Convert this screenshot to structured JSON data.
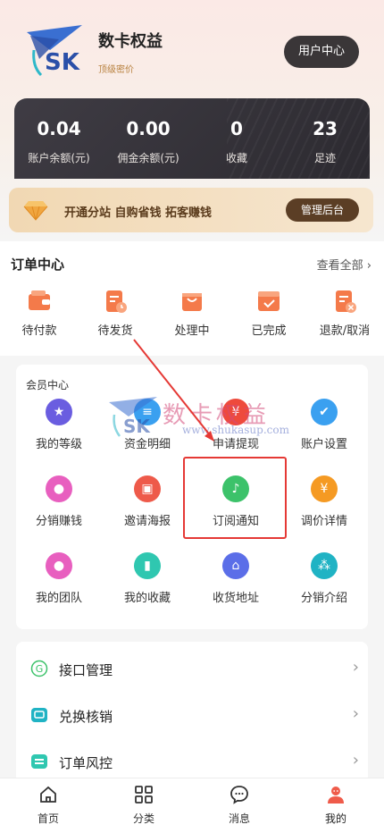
{
  "header": {
    "brand_name": "数卡权益",
    "brand_sub": "顶级密价",
    "logo_text": "SK",
    "user_center_label": "用户中心"
  },
  "stats": [
    {
      "value": "0.04",
      "label": "账户余额(元)"
    },
    {
      "value": "0.00",
      "label": "佣金余额(元)"
    },
    {
      "value": "0",
      "label": "收藏"
    },
    {
      "value": "23",
      "label": "足迹"
    }
  ],
  "promo": {
    "text": "开通分站 自购省钱 拓客赚钱",
    "button_label": "管理后台"
  },
  "orders": {
    "title": "订单中心",
    "view_all": "查看全部",
    "items": [
      {
        "label": "待付款",
        "icon": "wallet-icon"
      },
      {
        "label": "待发货",
        "icon": "clipboard-icon"
      },
      {
        "label": "处理中",
        "icon": "shopping-bag-icon"
      },
      {
        "label": "已完成",
        "icon": "box-check-icon"
      },
      {
        "label": "退款/取消",
        "icon": "refund-icon"
      }
    ]
  },
  "members": {
    "title": "会员中心",
    "items": [
      {
        "label": "我的等级",
        "icon": "star-icon",
        "color": "#6a5de0"
      },
      {
        "label": "资金明细",
        "icon": "funds-icon",
        "color": "#3aa0f0"
      },
      {
        "label": "申请提现",
        "icon": "yen-icon",
        "color": "#ee4a3c"
      },
      {
        "label": "账户设置",
        "icon": "shield-icon",
        "color": "#3aa0f0"
      },
      {
        "label": "分销赚钱",
        "icon": "distribution-icon",
        "color": "#e85fbf"
      },
      {
        "label": "邀请海报",
        "icon": "poster-icon",
        "color": "#ee5a4a"
      },
      {
        "label": "订阅通知",
        "icon": "bell-icon",
        "color": "#3cc26a"
      },
      {
        "label": "调价详情",
        "icon": "yen-icon",
        "color": "#f59a23"
      },
      {
        "label": "我的团队",
        "icon": "team-icon",
        "color": "#e85fbf"
      },
      {
        "label": "我的收藏",
        "icon": "bookmark-icon",
        "color": "#2fc7b0"
      },
      {
        "label": "收货地址",
        "icon": "home-icon",
        "color": "#5b6ee8"
      },
      {
        "label": "分销介绍",
        "icon": "network-icon",
        "color": "#20b3c4"
      }
    ]
  },
  "watermark": {
    "text": "数卡权益",
    "url": "www.shukasup.com"
  },
  "list": [
    {
      "label": "接口管理",
      "icon": "api-icon"
    },
    {
      "label": "兑换核销",
      "icon": "redeem-icon"
    },
    {
      "label": "订单风控",
      "icon": "risk-control-icon"
    }
  ],
  "tabbar": [
    {
      "label": "首页",
      "icon": "home-icon"
    },
    {
      "label": "分类",
      "icon": "grid-icon"
    },
    {
      "label": "消息",
      "icon": "message-icon"
    },
    {
      "label": "我的",
      "icon": "user-icon"
    }
  ]
}
